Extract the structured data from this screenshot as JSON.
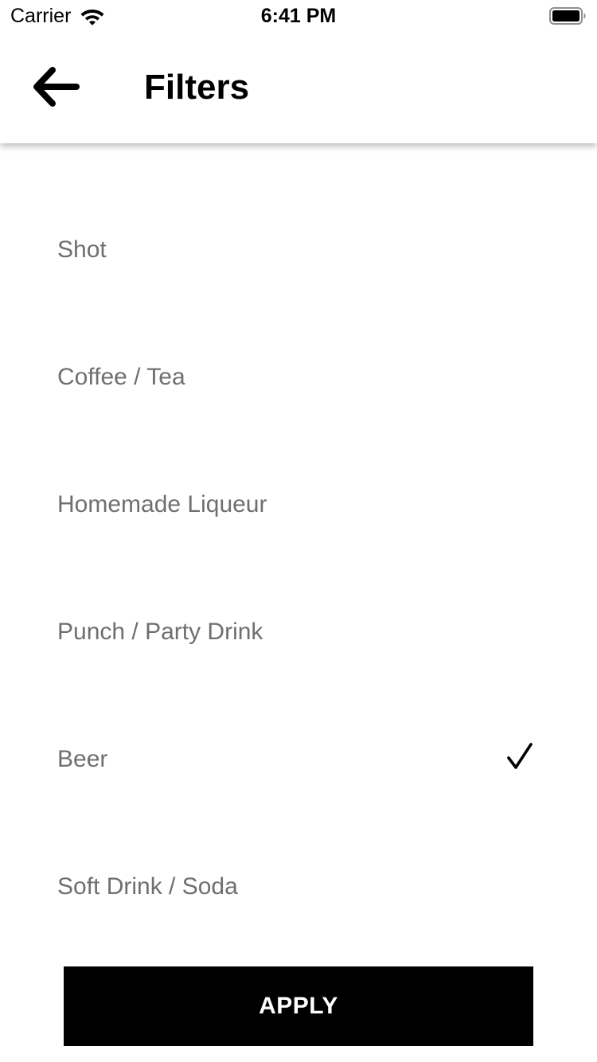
{
  "status_bar": {
    "carrier": "Carrier",
    "time": "6:41 PM",
    "wifi_icon": "wifi-icon",
    "battery_icon": "battery-full-icon"
  },
  "header": {
    "back_icon": "arrow-left-icon",
    "title": "Filters"
  },
  "filters": [
    {
      "label": "Shot",
      "selected": false
    },
    {
      "label": "Coffee / Tea",
      "selected": false
    },
    {
      "label": "Homemade Liqueur",
      "selected": false
    },
    {
      "label": "Punch / Party Drink",
      "selected": false
    },
    {
      "label": "Beer",
      "selected": true
    },
    {
      "label": "Soft Drink / Soda",
      "selected": false
    }
  ],
  "check_icon": "checkmark-icon",
  "apply_button": {
    "label": "APPLY"
  },
  "colors": {
    "background": "#ffffff",
    "text_primary": "#000000",
    "text_secondary": "#6f6f6f",
    "button_background": "#000000",
    "button_text": "#ffffff"
  }
}
